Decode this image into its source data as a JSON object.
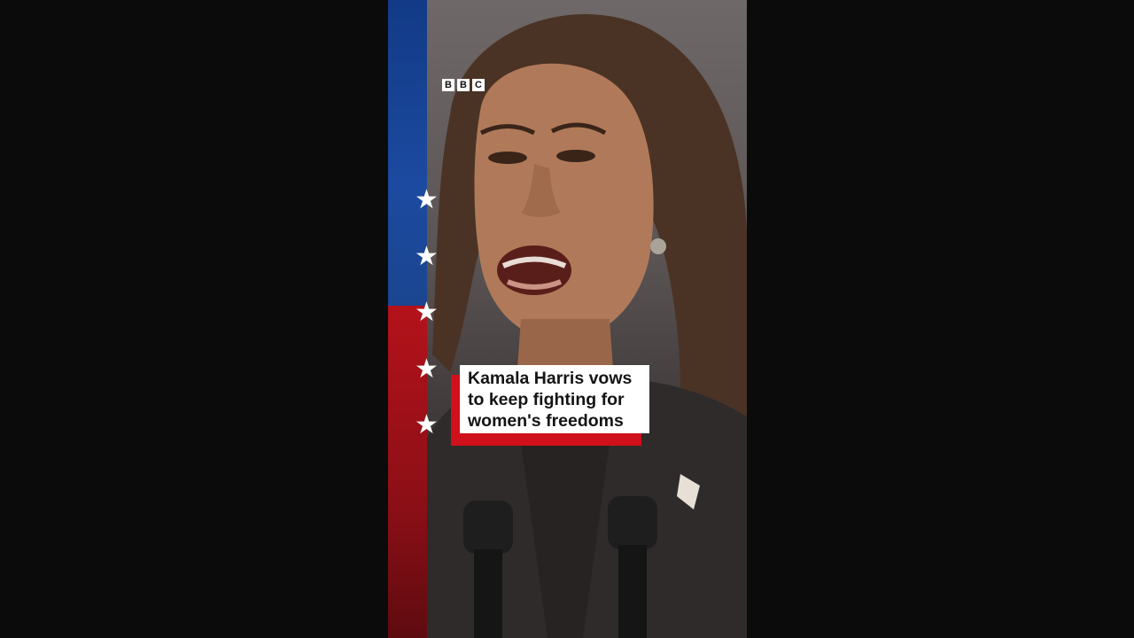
{
  "brand": {
    "letters": [
      "B",
      "B",
      "C"
    ],
    "logo_name": "BBC"
  },
  "caption": {
    "lines": [
      "Kamala Harris vows",
      "to keep fighting for",
      "women's freedoms"
    ],
    "accent_color": "#d0101b"
  },
  "decor": {
    "star_glyph": "★",
    "star_count": 5,
    "flag_colors": {
      "blue": "#1c4aa0",
      "red": "#b4121a"
    }
  },
  "scene": {
    "description_icon": "speaker-at-podium-image"
  }
}
